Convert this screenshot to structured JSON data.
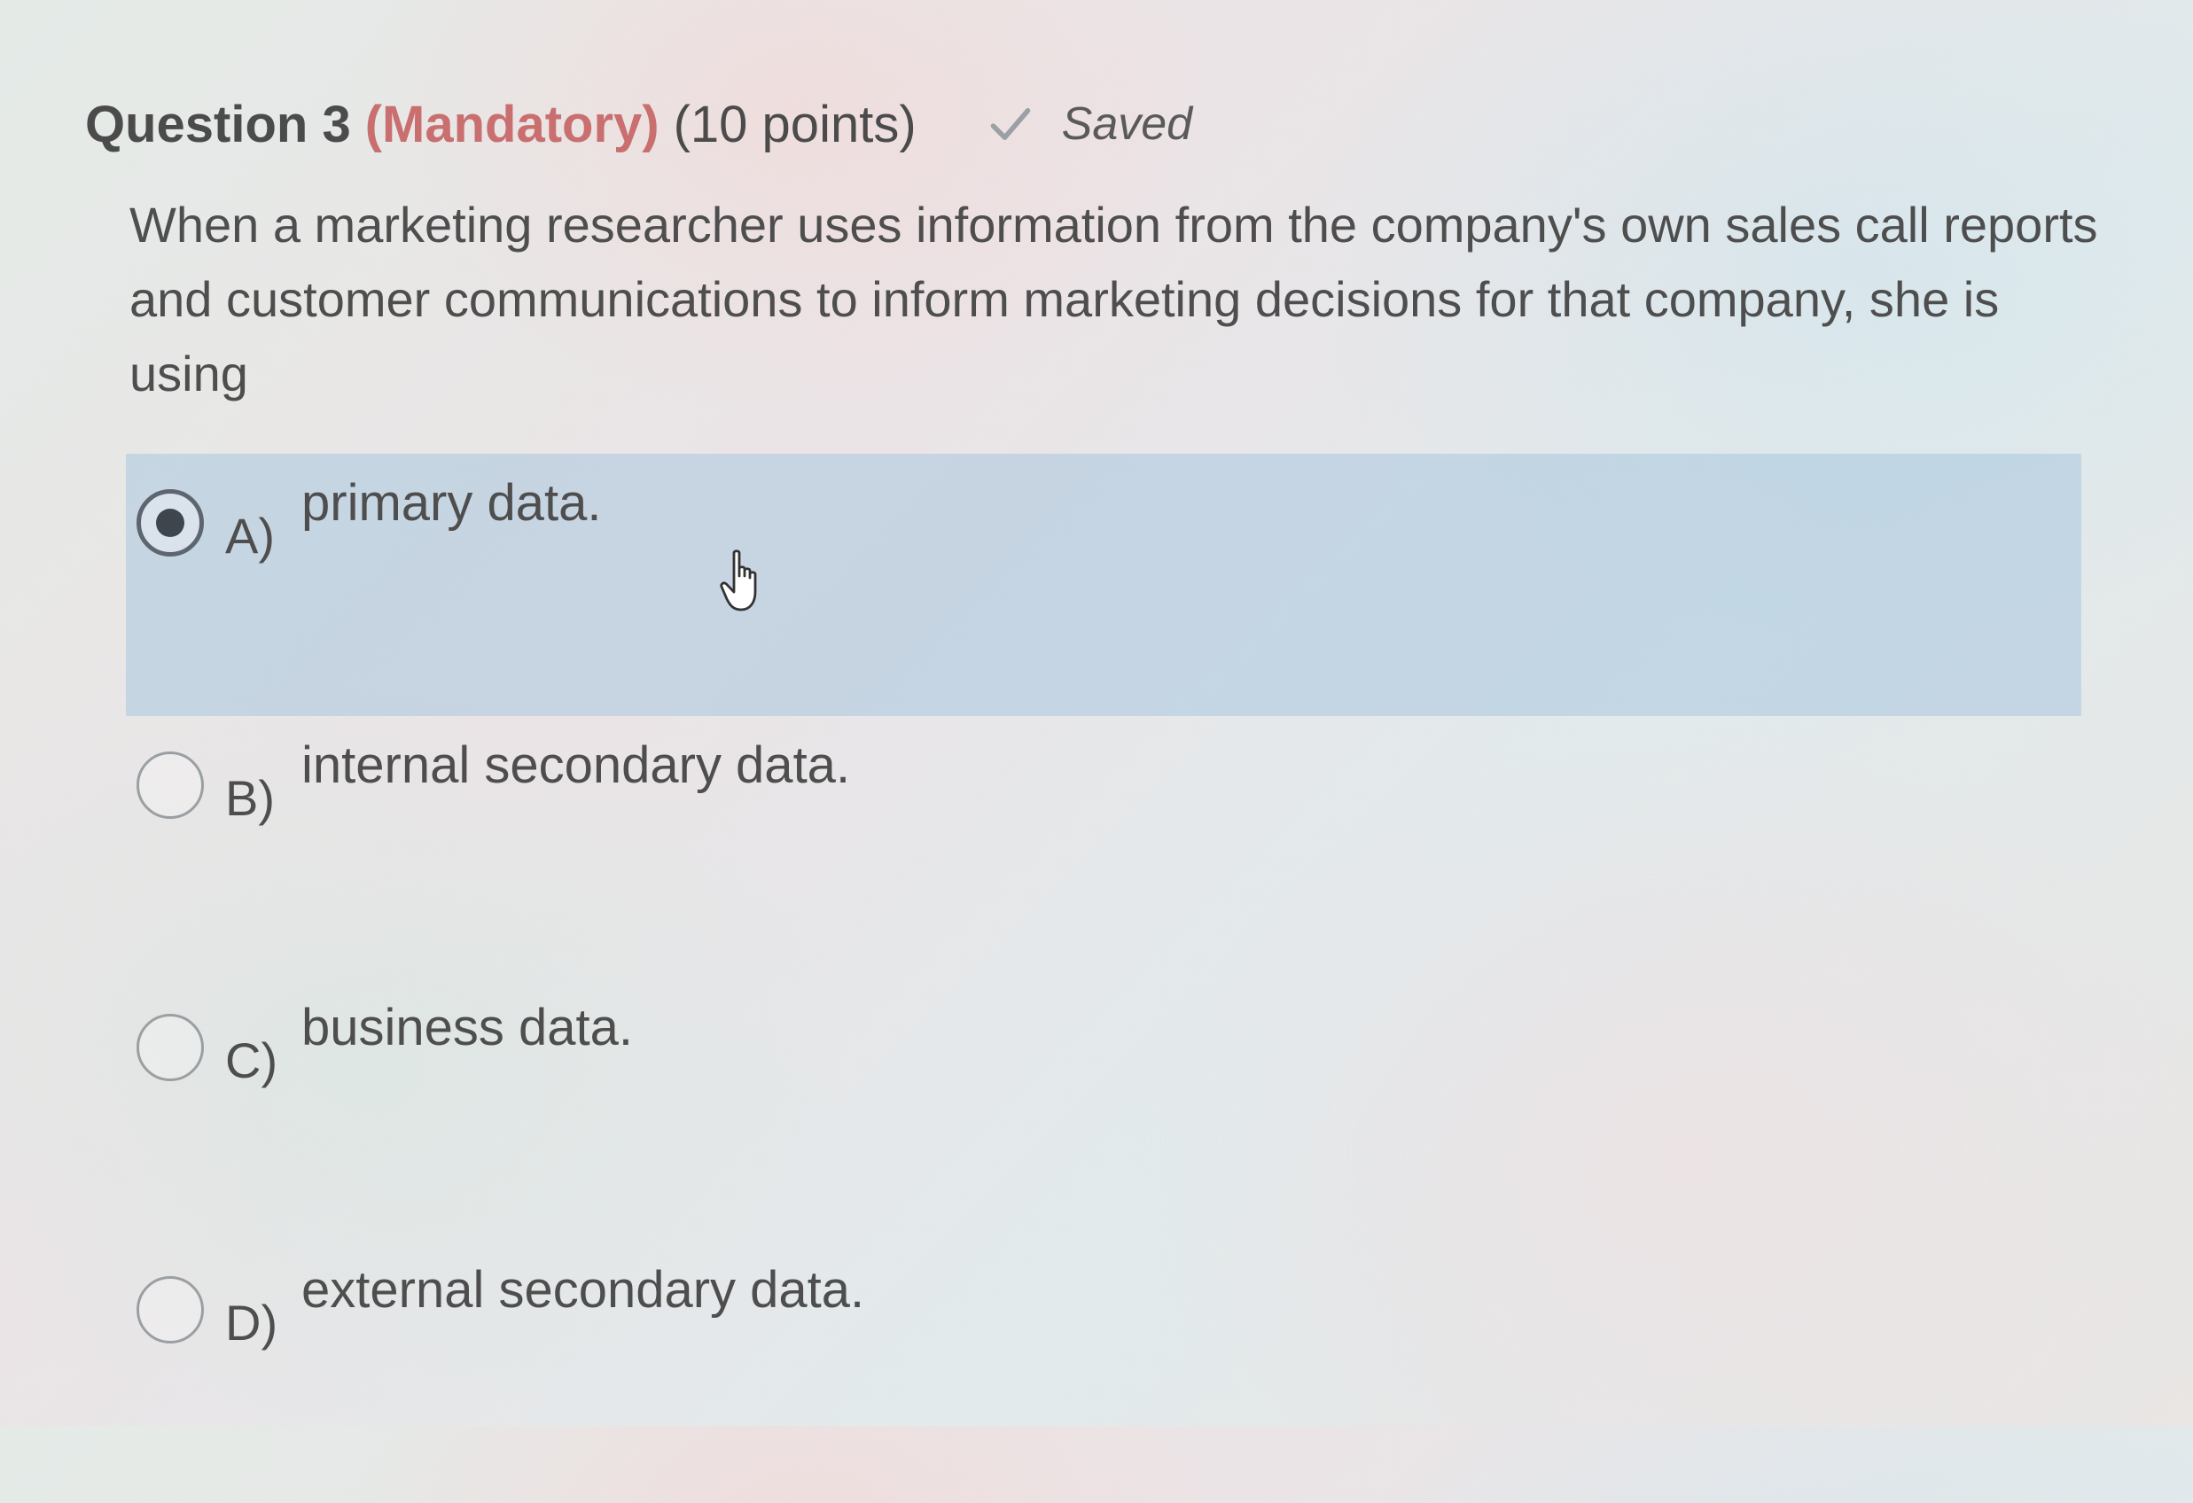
{
  "question": {
    "title": "Question 3",
    "mandatory": "(Mandatory)",
    "points": "(10 points)",
    "status": "Saved",
    "status_icon": "checkmark-icon",
    "text": "When a marketing researcher uses information from the company's own sales call reports and customer communications to inform marketing decisions for that company, she is using"
  },
  "answers": [
    {
      "letter": "A)",
      "text": "primary data.",
      "selected": true
    },
    {
      "letter": "B)",
      "text": "internal secondary data.",
      "selected": false
    },
    {
      "letter": "C)",
      "text": "business data.",
      "selected": false
    },
    {
      "letter": "D)",
      "text": "external secondary data.",
      "selected": false
    }
  ],
  "colors": {
    "mandatory": "#c96f70",
    "selected_background": "#aac6de",
    "text": "#4e4e4e"
  },
  "cursor": "pointer-hand-icon"
}
